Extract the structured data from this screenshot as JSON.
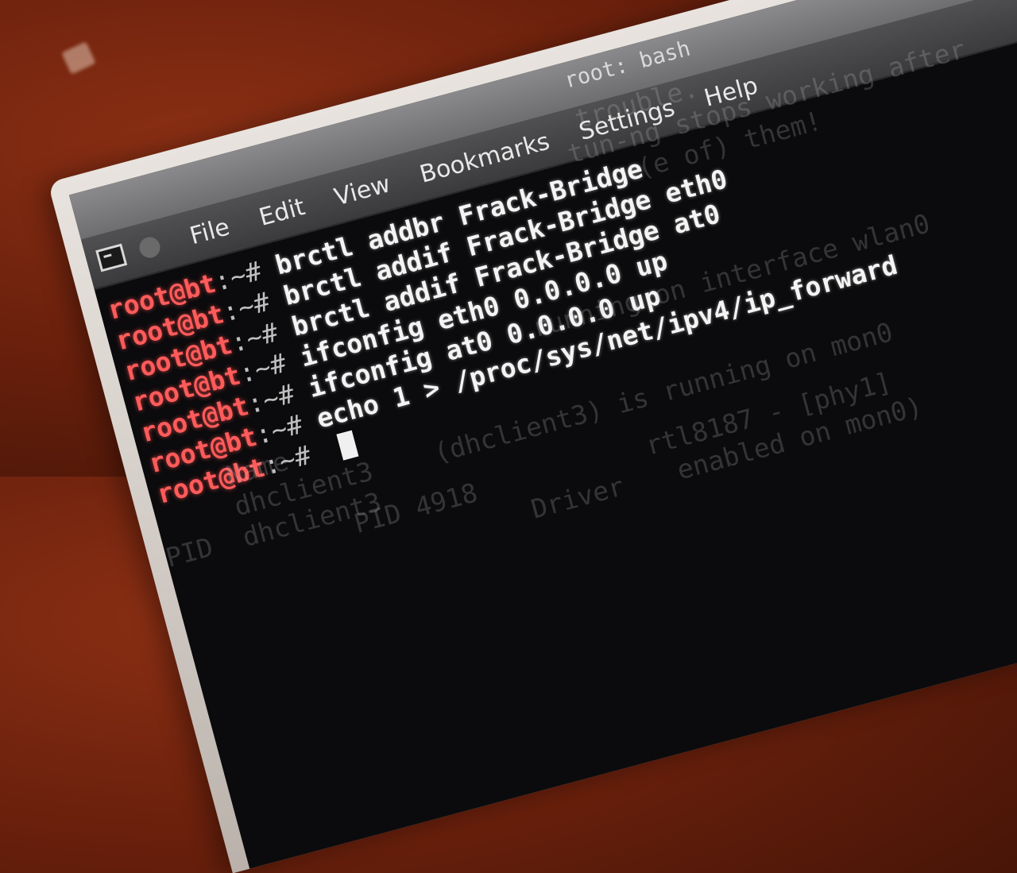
{
  "window": {
    "title": "root: bash"
  },
  "menu": {
    "file": "File",
    "edit": "Edit",
    "view": "View",
    "bookmarks": "Bookmarks",
    "settings": "Settings",
    "help": "Help"
  },
  "terminal": {
    "user": "root@bt",
    "separator": ":~# ",
    "commands": [
      "brctl addbr Frack-Bridge",
      "brctl addif Frack-Bridge eth0",
      "brctl addif Frack-Bridge at0",
      "ifconfig eth0 0.0.0.0 up",
      "ifconfig at0 0.0.0.0 up",
      "echo 1 > /proc/sys/net/ipv4/ip_forward",
      ""
    ],
    "ghost_lines": [
      "trouble.",
      "tun-ng stops working after",
      "(e of) them!",
      "running on interface wlan0",
      "Name",
      "dhclient3",
      "dhclient3",
      "(dhclient3) is running on mon0",
      "PID 4918",
      "Driver",
      "rtl8187 - [phy1]",
      "enabled on mon0)",
      "PID"
    ]
  }
}
